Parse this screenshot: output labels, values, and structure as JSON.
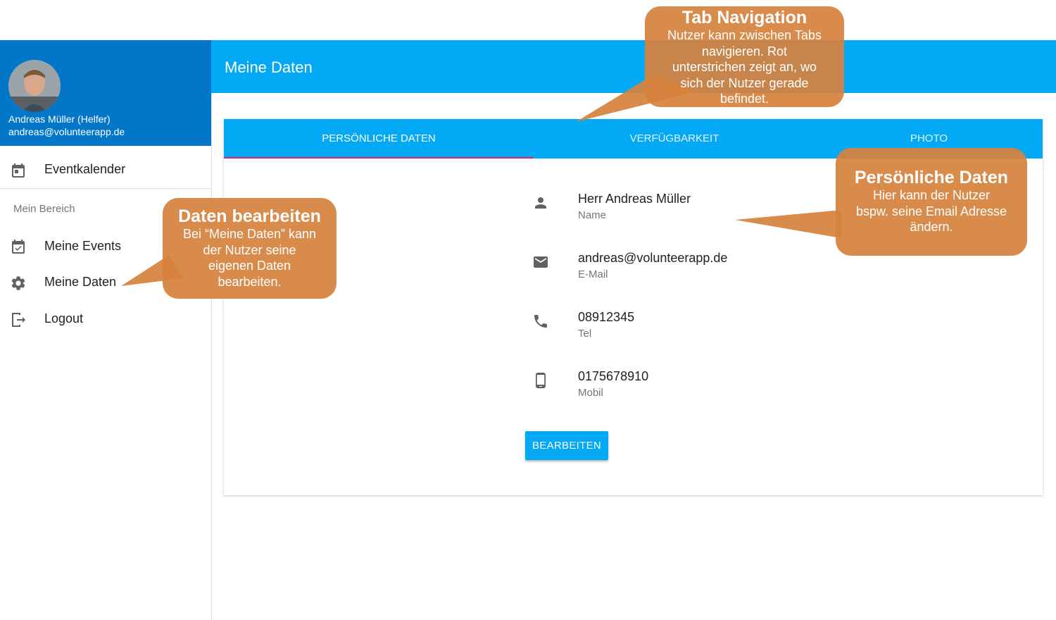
{
  "sidebar": {
    "user_name": "Andreas Müller (Helfer)",
    "user_email": "andreas@volunteerapp.de",
    "items": [
      {
        "label": "Eventkalender",
        "icon": "calendar-icon"
      },
      {
        "label": "Meine Events",
        "icon": "calendar-check-icon"
      },
      {
        "label": "Meine Daten",
        "icon": "gear-icon"
      },
      {
        "label": "Logout",
        "icon": "logout-icon"
      }
    ],
    "subheader": "Mein Bereich"
  },
  "appbar": {
    "title": "Meine Daten"
  },
  "tabs": [
    {
      "label": "PERSÖNLICHE DATEN",
      "active": true
    },
    {
      "label": "VERFÜGBARKEIT",
      "active": false
    },
    {
      "label": "PHOTO",
      "active": false
    }
  ],
  "fields": [
    {
      "value": "Herr Andreas Müller",
      "caption": "Name",
      "icon": "person-icon"
    },
    {
      "value": "andreas@volunteerapp.de",
      "caption": "E-Mail",
      "icon": "mail-icon"
    },
    {
      "value": "08912345",
      "caption": "Tel",
      "icon": "phone-icon"
    },
    {
      "value": "0175678910",
      "caption": "Mobil",
      "icon": "smartphone-icon"
    }
  ],
  "edit_button": "BEARBEITEN",
  "callouts": {
    "tabs": {
      "title": "Tab Navigation",
      "lines": [
        "Nutzer kann zwischen Tabs",
        "navigieren. Rot",
        "unterstrichen zeigt an, wo",
        "sich der Nutzer gerade",
        "befindet."
      ]
    },
    "edit": {
      "title": "Daten bearbeiten",
      "lines": [
        "Bei “Meine Daten” kann",
        "der Nutzer seine",
        "eigenen Daten",
        "bearbeiten."
      ]
    },
    "personal": {
      "title": "Persönliche Daten",
      "lines": [
        "Hier kann der Nutzer",
        "bspw. seine Email Adresse",
        "ändern."
      ]
    }
  },
  "colors": {
    "primary": "#03a9f4",
    "sidebar_header": "#0277c8",
    "tab_indicator": "#e91e63",
    "callout": "#d6823e"
  }
}
